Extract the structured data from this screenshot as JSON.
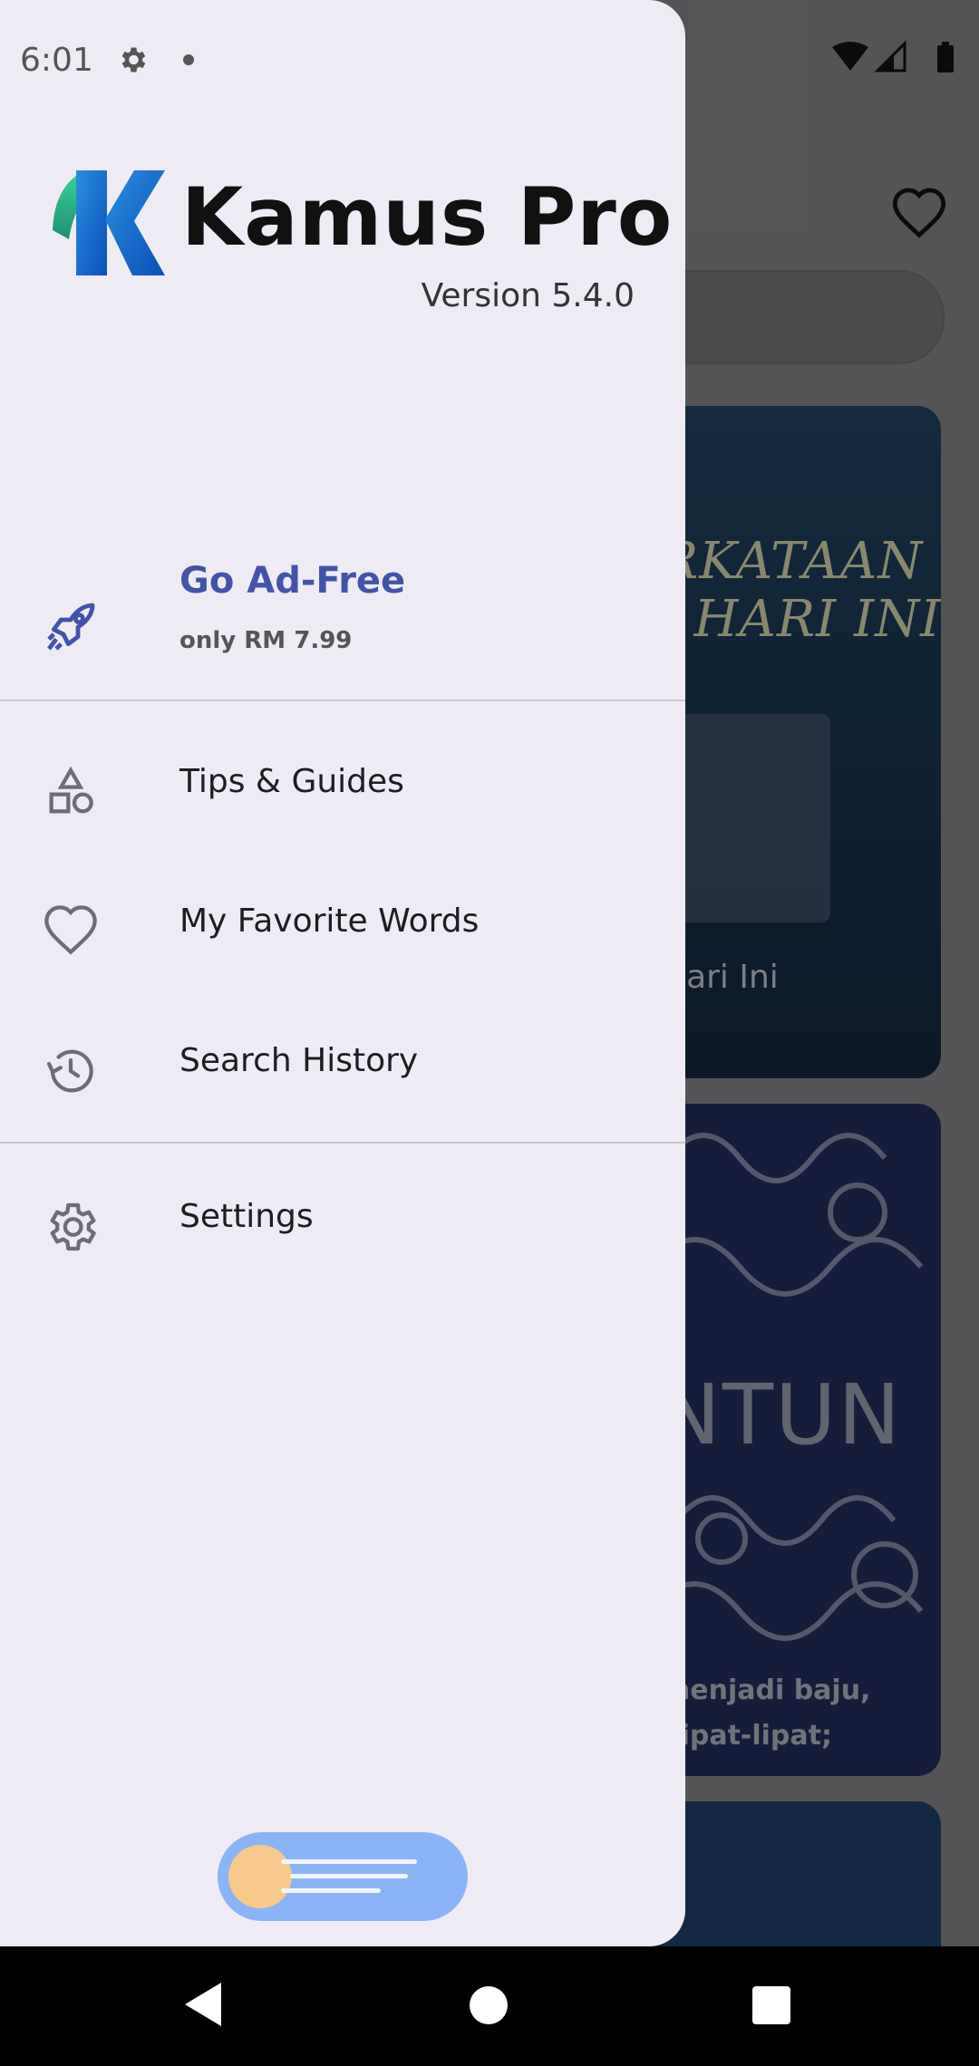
{
  "status_bar": {
    "time": "6:01"
  },
  "drawer": {
    "app_name": "Kamus Pro",
    "version": "Version 5.4.0",
    "premium": {
      "title": "Go Ad-Free",
      "subtitle": "only RM 7.99",
      "icon": "rocket-icon"
    },
    "menu": [
      {
        "label": "Tips & Guides",
        "icon": "shapes-icon"
      },
      {
        "label": "My Favorite Words",
        "icon": "heart-outline-icon"
      },
      {
        "label": "Search History",
        "icon": "history-icon"
      }
    ],
    "settings": {
      "label": "Settings",
      "icon": "gear-icon"
    },
    "accent_color": "#4254a9",
    "background_color": "#efebf5"
  },
  "background": {
    "card1_title": "RKATAAN\n  HARI INI",
    "card1_subtitle": "Hari Ini",
    "card2_title": "NTUN",
    "card2_line1": "menjadi baju,",
    "card2_line2": "ilipat-lipat;"
  },
  "theme_toggle": {
    "state": "day"
  }
}
